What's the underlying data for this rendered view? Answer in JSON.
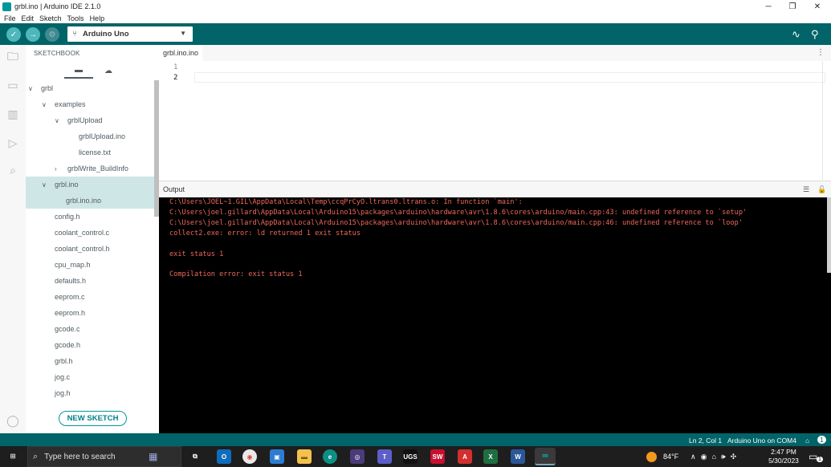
{
  "window": {
    "title": "grbl.ino | Arduino IDE 2.1.0"
  },
  "menu": [
    "File",
    "Edit",
    "Sketch",
    "Tools",
    "Help"
  ],
  "toolbar": {
    "board": "Arduino Uno"
  },
  "sidebar": {
    "header": "SKETCHBOOK",
    "tree": [
      {
        "label": "grbl",
        "twisty": "∨"
      },
      {
        "label": "examples",
        "twisty": "∨"
      },
      {
        "label": "grblUpload",
        "twisty": "∨"
      },
      {
        "label": "grblUpload.ino",
        "twisty": ""
      },
      {
        "label": "license.txt",
        "twisty": ""
      },
      {
        "label": "grblWrite_BuildInfo",
        "twisty": "›"
      },
      {
        "label": "grbl.ino",
        "twisty": "∨"
      },
      {
        "label": "grbl.ino.ino",
        "twisty": ""
      },
      {
        "label": "config.h",
        "twisty": ""
      },
      {
        "label": "coolant_control.c",
        "twisty": ""
      },
      {
        "label": "coolant_control.h",
        "twisty": ""
      },
      {
        "label": "cpu_map.h",
        "twisty": ""
      },
      {
        "label": "defaults.h",
        "twisty": ""
      },
      {
        "label": "eeprom.c",
        "twisty": ""
      },
      {
        "label": "eeprom.h",
        "twisty": ""
      },
      {
        "label": "gcode.c",
        "twisty": ""
      },
      {
        "label": "gcode.h",
        "twisty": ""
      },
      {
        "label": "grbl.h",
        "twisty": ""
      },
      {
        "label": "jog.c",
        "twisty": ""
      },
      {
        "label": "jog.h",
        "twisty": ""
      }
    ],
    "new_sketch": "NEW SKETCH"
  },
  "editor": {
    "tab": "grbl.ino.ino",
    "line_numbers": [
      "1",
      "2"
    ]
  },
  "output": {
    "title": "Output",
    "lines": [
      "C:\\Users\\JOEL~1.GIL\\AppData\\Local\\Temp\\ccqPrCyO.ltrans0.ltrans.o: In function `main':",
      "C:\\Users\\joel.gillard\\AppData\\Local\\Arduino15\\packages\\arduino\\hardware\\avr\\1.8.6\\cores\\arduino/main.cpp:43: undefined reference to `setup'",
      "C:\\Users\\joel.gillard\\AppData\\Local\\Arduino15\\packages\\arduino\\hardware\\avr\\1.8.6\\cores\\arduino/main.cpp:46: undefined reference to `loop'",
      "collect2.exe: error: ld returned 1 exit status",
      "",
      "exit status 1",
      "",
      "Compilation error: exit status 1"
    ]
  },
  "status": {
    "position": "Ln 2, Col 1",
    "board_port": "Arduino Uno on COM4",
    "notif_count": "1"
  },
  "taskbar": {
    "search_placeholder": "Type here to search",
    "temperature": "84°F",
    "time": "2:47 PM",
    "date": "5/30/2023",
    "notif_badge": "1"
  },
  "colors": {
    "teal": "#006468",
    "accent": "#00979c",
    "error": "#f0685c"
  }
}
